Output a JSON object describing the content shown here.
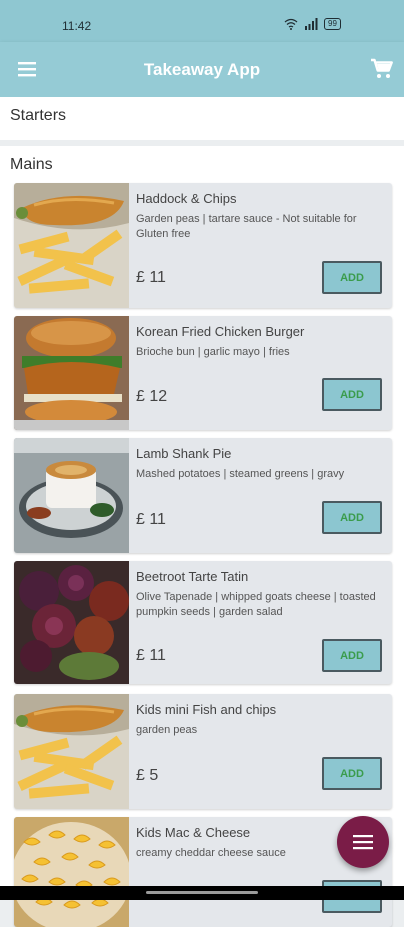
{
  "status_bar": {
    "time": "11:42",
    "battery": "99"
  },
  "app_bar": {
    "title": "Takeaway App",
    "menu_icon": "hamburger-menu-icon",
    "cart_icon": "shopping-cart-icon"
  },
  "sections": {
    "starters": "Starters",
    "mains": "Mains"
  },
  "items": [
    {
      "name": "Haddock & Chips",
      "desc": "Garden peas | tartare sauce - Not suitable for Gluten free",
      "price": "£ 11",
      "button": "ADD"
    },
    {
      "name": "Korean Fried Chicken Burger",
      "desc": "Brioche bun | garlic mayo | fries",
      "price": "£ 12",
      "button": "ADD"
    },
    {
      "name": "Lamb Shank Pie",
      "desc": "Mashed potatoes | steamed greens | gravy",
      "price": "£ 11",
      "button": "ADD"
    },
    {
      "name": "Beetroot Tarte Tatin",
      "desc": "Olive Tapenade | whipped goats cheese | toasted pumpkin seeds | garden salad",
      "price": "£ 11",
      "button": "ADD"
    },
    {
      "name": "Kids mini Fish and chips",
      "desc": "garden peas",
      "price": "£ 5",
      "button": "ADD"
    },
    {
      "name": "Kids Mac & Cheese",
      "desc": "creamy cheddar cheese sauce",
      "price": "",
      "button": "ADD"
    }
  ],
  "fab": {
    "icon": "menu-list-icon"
  },
  "colors": {
    "app_bar": "#95cbd5",
    "status_bar": "#8fc7d1",
    "add_button": "#8cc6d0",
    "add_text": "#3a9c4c",
    "fab": "#7a1c47"
  }
}
